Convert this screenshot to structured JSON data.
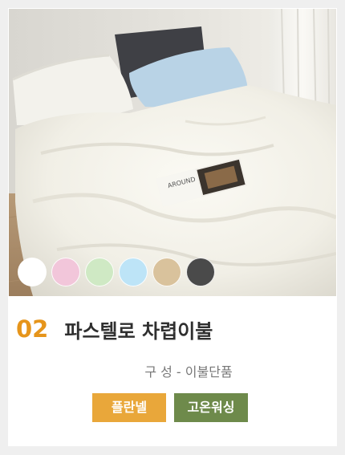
{
  "product": {
    "number": "02",
    "title": "파스텔로 차렵이불",
    "composition": "구 성 - 이불단품",
    "book_text": "AROUND",
    "tags": [
      {
        "label": "플란넬",
        "color": "#e9a73a"
      },
      {
        "label": "고온워싱",
        "color": "#6e8a4b"
      }
    ],
    "swatches": [
      {
        "name": "white",
        "color": "#ffffff"
      },
      {
        "name": "pink",
        "color": "#f2c6da"
      },
      {
        "name": "mint",
        "color": "#cfe9c4"
      },
      {
        "name": "sky-blue",
        "color": "#bde4f7"
      },
      {
        "name": "beige",
        "color": "#d9c29c"
      },
      {
        "name": "charcoal",
        "color": "#4a4a4a"
      }
    ]
  }
}
